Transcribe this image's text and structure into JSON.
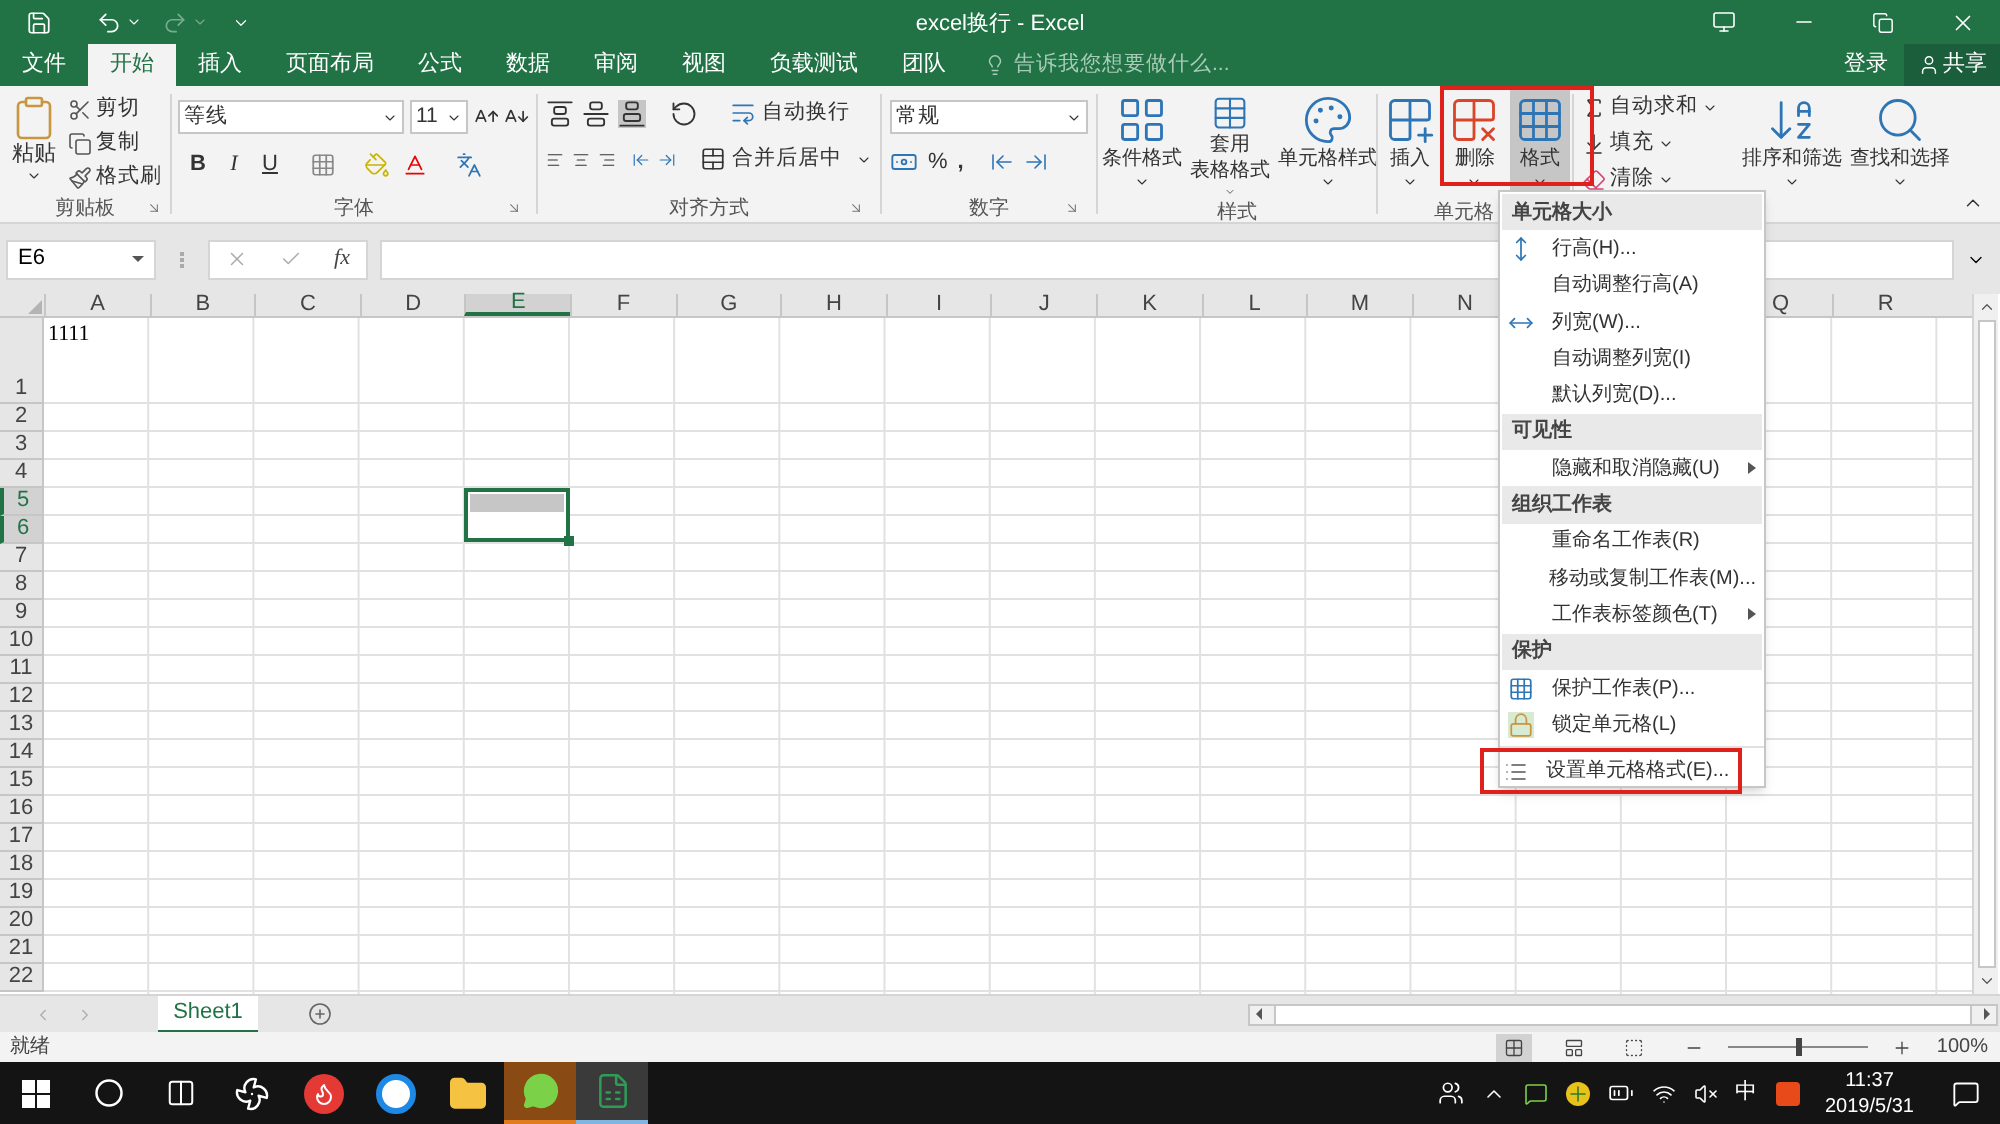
{
  "title_bar": {
    "title": "excel换行 - Excel"
  },
  "tabs": [
    {
      "label": "文件",
      "selected": false
    },
    {
      "label": "开始",
      "selected": true
    },
    {
      "label": "插入",
      "selected": false
    },
    {
      "label": "页面布局",
      "selected": false
    },
    {
      "label": "公式",
      "selected": false
    },
    {
      "label": "数据",
      "selected": false
    },
    {
      "label": "审阅",
      "selected": false
    },
    {
      "label": "视图",
      "selected": false
    },
    {
      "label": "负载测试",
      "selected": false
    },
    {
      "label": "团队",
      "selected": false
    }
  ],
  "tell_me": {
    "placeholder": "告诉我您想要做什么..."
  },
  "account": {
    "sign_in": "登录",
    "share": "共享"
  },
  "ribbon": {
    "clipboard": {
      "label": "剪贴板",
      "paste": "粘贴",
      "items": [
        "剪切",
        "复制",
        "格式刷"
      ]
    },
    "font": {
      "label": "字体",
      "font_name": "等线",
      "font_size": "11",
      "style_buttons": [
        "B",
        "I",
        "U"
      ]
    },
    "alignment": {
      "label": "对齐方式",
      "wrap_text": "自动换行",
      "merge_center": "合并后居中"
    },
    "number": {
      "label": "数字",
      "format": "常规",
      "percent": "%",
      "comma": ","
    },
    "styles": {
      "label": "样式",
      "buttons": [
        [
          "条件格式"
        ],
        [
          "套用",
          "表格格式"
        ],
        [
          "单元格样式"
        ]
      ]
    },
    "cells": {
      "label": "单元格",
      "buttons": [
        {
          "label": "插入",
          "pressed": false
        },
        {
          "label": "删除",
          "pressed": false
        },
        {
          "label": "格式",
          "pressed": true
        }
      ]
    },
    "editing": {
      "small": [
        "自动求和",
        "填充",
        "清除"
      ],
      "big": [
        "排序和筛选",
        "查找和选择"
      ]
    }
  },
  "formula_bar": {
    "name_box": "E6",
    "fx": "fx"
  },
  "sheet": {
    "columns": [
      {
        "label": "A",
        "selected": false
      },
      {
        "label": "B",
        "selected": false
      },
      {
        "label": "C",
        "selected": false
      },
      {
        "label": "D",
        "selected": false
      },
      {
        "label": "E",
        "selected": true
      },
      {
        "label": "F",
        "selected": false
      },
      {
        "label": "G",
        "selected": false
      },
      {
        "label": "H",
        "selected": false
      },
      {
        "label": "I",
        "selected": false
      },
      {
        "label": "J",
        "selected": false
      },
      {
        "label": "K",
        "selected": false
      },
      {
        "label": "L",
        "selected": false
      },
      {
        "label": "M",
        "selected": false
      },
      {
        "label": "N",
        "selected": false
      }
    ],
    "columns_right_of_menu": [
      {
        "label": "Q",
        "selected": false
      },
      {
        "label": "R",
        "selected": false
      }
    ],
    "rows": [
      {
        "label": "1",
        "selected": false,
        "cells": [
          "1111"
        ]
      },
      {
        "label": "2",
        "selected": false,
        "cells": []
      },
      {
        "label": "3",
        "selected": false,
        "cells": []
      },
      {
        "label": "4",
        "selected": false,
        "cells": []
      },
      {
        "label": "5",
        "selected": true,
        "cells": []
      },
      {
        "label": "6",
        "selected": true,
        "cells": []
      },
      {
        "label": "7",
        "selected": false,
        "cells": []
      },
      {
        "label": "8",
        "selected": false,
        "cells": []
      },
      {
        "label": "9",
        "selected": false,
        "cells": []
      },
      {
        "label": "10",
        "selected": false,
        "cells": []
      },
      {
        "label": "11",
        "selected": false,
        "cells": []
      },
      {
        "label": "12",
        "selected": false,
        "cells": []
      },
      {
        "label": "13",
        "selected": false,
        "cells": []
      },
      {
        "label": "14",
        "selected": false,
        "cells": []
      },
      {
        "label": "15",
        "selected": false,
        "cells": []
      },
      {
        "label": "16",
        "selected": false,
        "cells": []
      },
      {
        "label": "17",
        "selected": false,
        "cells": []
      },
      {
        "label": "18",
        "selected": false,
        "cells": []
      },
      {
        "label": "19",
        "selected": false,
        "cells": []
      },
      {
        "label": "20",
        "selected": false,
        "cells": []
      },
      {
        "label": "21",
        "selected": false,
        "cells": []
      },
      {
        "label": "22",
        "selected": false,
        "cells": []
      }
    ]
  },
  "menu": {
    "sections": [
      {
        "heading": "单元格大小",
        "items": [
          {
            "label": "行高(H)...",
            "submenu": false
          },
          {
            "label": "自动调整行高(A)",
            "submenu": false
          },
          {
            "label": "列宽(W)...",
            "submenu": false
          },
          {
            "label": "自动调整列宽(I)",
            "submenu": false
          },
          {
            "label": "默认列宽(D)...",
            "submenu": false
          }
        ]
      },
      {
        "heading": "可见性",
        "items": [
          {
            "label": "隐藏和取消隐藏(U)",
            "submenu": true
          }
        ]
      },
      {
        "heading": "组织工作表",
        "items": [
          {
            "label": "重命名工作表(R)",
            "submenu": false
          },
          {
            "label": "移动或复制工作表(M)...",
            "submenu": false
          },
          {
            "label": "工作表标签颜色(T)",
            "submenu": true
          }
        ]
      },
      {
        "heading": "保护",
        "items": [
          {
            "label": "保护工作表(P)...",
            "submenu": false
          },
          {
            "label": "锁定单元格(L)",
            "submenu": false
          }
        ]
      }
    ],
    "footer_item": "设置单元格格式(E)..."
  },
  "sheet_tabs": [
    {
      "label": "Sheet1",
      "selected": true
    }
  ],
  "status_bar": {
    "status": "就绪",
    "view_buttons": [
      {
        "selected": true
      },
      {
        "selected": false
      },
      {
        "selected": false
      }
    ],
    "zoom_slider": {
      "level": 0.5
    },
    "zoom": "100%"
  },
  "taskbar": {
    "apps": [
      {
        "kind": "start",
        "active": false
      },
      {
        "kind": "search",
        "active": false
      },
      {
        "kind": "task-view",
        "active": false
      },
      {
        "kind": "fan",
        "active": false
      },
      {
        "kind": "flame",
        "active": false
      },
      {
        "kind": "browser",
        "active": false
      },
      {
        "kind": "folder",
        "active": false
      },
      {
        "kind": "chat",
        "active": true
      },
      {
        "kind": "spreadsheet",
        "active": true
      }
    ],
    "tray": {
      "ime": "中",
      "time": "11:37",
      "date": "2019/5/31"
    }
  }
}
